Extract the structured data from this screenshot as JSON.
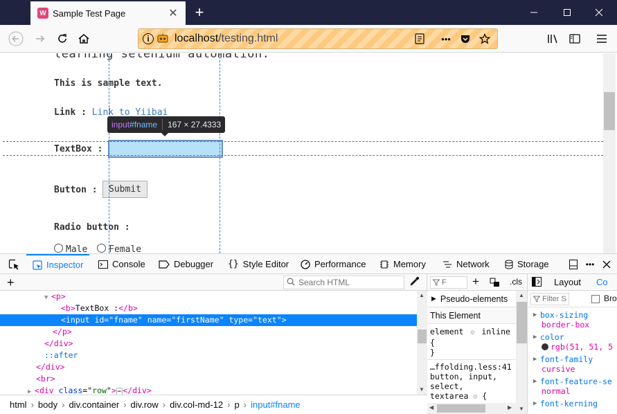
{
  "browser": {
    "tab_title": "Sample Test Page",
    "favicon_letter": "W",
    "url_host": "localhost",
    "url_path": "/testing.html"
  },
  "page": {
    "cut_text": "learning selenium automation.",
    "sample_text": "This is sample text.",
    "link_label": "Link :",
    "link_text": "Link to Yiibai",
    "textbox_label": "TextBox :",
    "button_label": "Button :",
    "submit_label": "Submit",
    "radio_label": "Radio button :",
    "radio_male": "Male",
    "radio_female": "Female"
  },
  "highlighter": {
    "tag": "input",
    "id": "#fname",
    "dimensions": "167 × 27.4333"
  },
  "devtools": {
    "tabs": [
      {
        "label": "Inspector",
        "icon": "inspector-icon"
      },
      {
        "label": "Console",
        "icon": "console-icon"
      },
      {
        "label": "Debugger",
        "icon": "debugger-icon"
      },
      {
        "label": "Style Editor",
        "icon": "style-editor-icon"
      },
      {
        "label": "Performance",
        "icon": "performance-icon"
      },
      {
        "label": "Memory",
        "icon": "memory-icon"
      },
      {
        "label": "Network",
        "icon": "network-icon"
      },
      {
        "label": "Storage",
        "icon": "storage-icon"
      }
    ],
    "search_placeholder": "Search HTML",
    "markup": [
      {
        "twisty": "▼",
        "open": "<p>",
        "tag": "p"
      },
      {
        "text_b_open": "<b>",
        "text": "TextBox :",
        "text_b_close": "</b>"
      },
      {
        "tag": "input",
        "attrs": [
          [
            "id",
            "fname"
          ],
          [
            "name",
            "firstName"
          ],
          [
            "type",
            "text"
          ]
        ]
      },
      {
        "close": "</p>"
      },
      {
        "close": "</div>"
      },
      {
        "pseudo": "::after"
      },
      {
        "close": "</div>"
      },
      {
        "open": "<br>"
      },
      {
        "twisty": "▶",
        "tag": "div",
        "class": "row",
        "ellipsis": "⋯",
        "close": "</div>"
      }
    ],
    "breadcrumbs": [
      "html",
      "body",
      "div.container",
      "div.row",
      "div.col-md-12",
      "p",
      "input#fname"
    ],
    "rules": {
      "filter_placeholder": "F",
      "cls_label": ".cls",
      "pseudo_elements": "Pseudo-elements",
      "this_element": "This Element",
      "element_rule_selector": "element",
      "element_rule_source": "inline",
      "rule2_source": "…ffolding.less:41",
      "rule2_selector_line1": "button, input,",
      "rule2_selector_line2": "select,",
      "rule2_selector_line3": "textarea"
    },
    "layout": {
      "tab_layout": "Layout",
      "tab_computed": "Co",
      "filter_placeholder": "Filter S",
      "browser_styles": "Bro",
      "properties": [
        {
          "name": "box-sizing",
          "value": "border-box"
        },
        {
          "name": "color",
          "value": "rgb(51, 51, 5",
          "swatch": "#333333"
        },
        {
          "name": "font-family",
          "value": "cursive"
        },
        {
          "name": "font-feature-se",
          "value": "normal"
        },
        {
          "name": "font-kerning",
          "value": ""
        }
      ]
    }
  },
  "colors": {
    "tab_bar": "#202340",
    "accent": "#0a84ff",
    "selected_row": "#0a84ff",
    "highlight_fill": "#b6e1f7"
  }
}
